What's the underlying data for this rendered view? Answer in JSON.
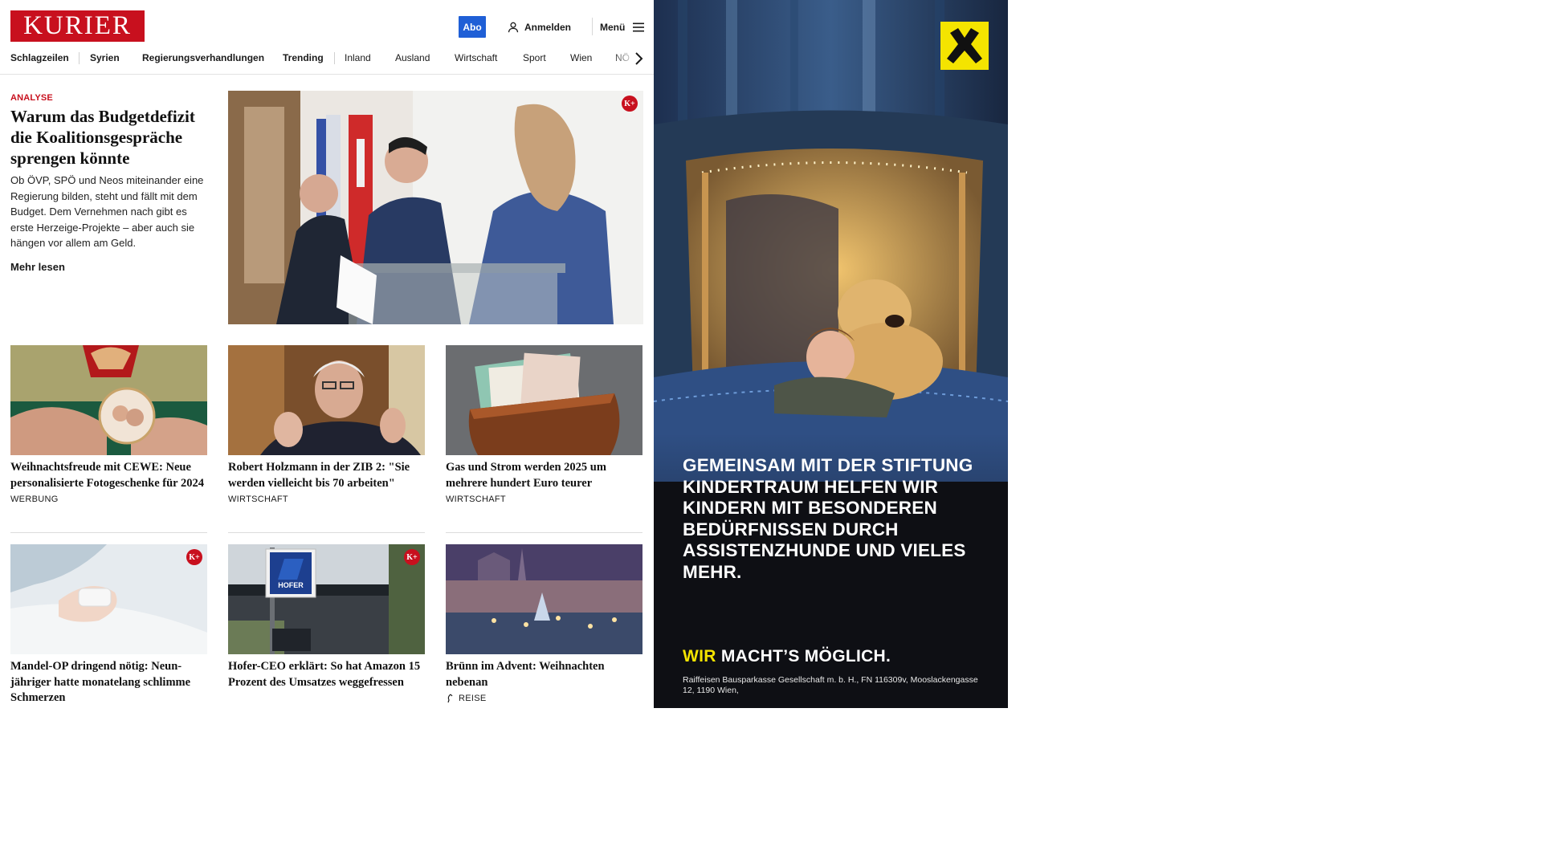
{
  "header": {
    "logo_text": "KURIER",
    "abo_label": "Abo",
    "login_label": "Anmelden",
    "menu_label": "Menü"
  },
  "nav": {
    "items": [
      {
        "label": "Schlagzeilen"
      },
      {
        "label": "Syrien"
      },
      {
        "label": "Regierungsverhandlungen"
      },
      {
        "label": "Trending"
      },
      {
        "label": "Inland"
      },
      {
        "label": "Ausland"
      },
      {
        "label": "Wirtschaft"
      },
      {
        "label": "Sport"
      },
      {
        "label": "Wien"
      },
      {
        "label": "NÖ"
      }
    ]
  },
  "hero": {
    "kicker": "ANALYSE",
    "title": "Warum das Budgetdefizit die Koalitionsgespräche sprengen könnte",
    "lead": "Ob ÖVP, SPÖ und Neos miteinander eine Regierung bilden, steht und fällt mit dem Budget. Dem Vernehmen nach gibt es erste Herzeige-Projekte – aber auch sie hängen vor allem am Geld.",
    "more_label": "Mehr lesen",
    "premium_badge": "K+"
  },
  "cards": [
    {
      "title": "Weihnachtsfreude mit CEWE: Neue personalisierte Fotogeschenke für 2024",
      "category": "WERBUNG"
    },
    {
      "title": "Robert Holzmann in der ZIB 2: \"Sie werden vielleicht bis 70 arbeiten\"",
      "category": "WIRTSCHAFT"
    },
    {
      "title": "Gas und Strom werden 2025 um mehrere hundert Euro teurer",
      "category": "WIRTSCHAFT"
    },
    {
      "title": "Mandel-OP dringend nötig: Neun-jähriger hatte monatelang schlimme Schmerzen",
      "category": "",
      "badge": "K+"
    },
    {
      "title": "Hofer-CEO erklärt: So hat Amazon 15 Prozent des Umsatzes weggefressen",
      "category": "",
      "badge": "K+",
      "sign_text": "HOFER"
    },
    {
      "title": "Brünn im Advent: Weihnachten nebenan",
      "category": "REISE"
    }
  ],
  "ad": {
    "headline": "GEMEINSAM MIT DER STIFTUNG KINDERTRAUM HELFEN WIR KINDERN MIT BESONDEREN BEDÜRFNISSEN DURCH ASSISTENZHUNDE UND VIELES MEHR.",
    "slogan_highlight": "WIR",
    "slogan_rest": "MACHT’S MÖGLICH.",
    "legal": "Raiffeisen Bausparkasse Gesellschaft m. b. H., FN 116309v, Mooslackengasse 12, 1190 Wien,",
    "accent_color": "#f4e400"
  },
  "colors": {
    "brand_red": "#c8101e",
    "abo_blue": "#1f5fd6"
  }
}
